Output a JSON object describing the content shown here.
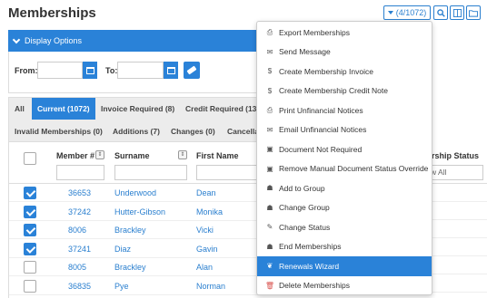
{
  "page": {
    "title": "Memberships"
  },
  "toolbar": {
    "count_label": "(4/1072)"
  },
  "display_options": {
    "label": "Display Options"
  },
  "filters": {
    "from_label": "From:",
    "to_label": "To:"
  },
  "tabs": [
    {
      "label": "All",
      "active": false
    },
    {
      "label": "Current (1072)",
      "active": true
    },
    {
      "label": "Invoice Required (8)",
      "active": false
    },
    {
      "label": "Credit Required (13",
      "active": false
    },
    {
      "label": "Invalid Memberships (0)",
      "active": false
    },
    {
      "label": "Additions (7)",
      "active": false
    },
    {
      "label": "Changes (0)",
      "active": false
    },
    {
      "label": "Cancella",
      "active": false
    }
  ],
  "table": {
    "headers": {
      "member_no": "Member #",
      "surname": "Surname",
      "first_name": "First Name"
    },
    "status_header": "ership Status",
    "status_filter": "w All",
    "rows": [
      {
        "checked": true,
        "member_no": "36653",
        "surname": "Underwood",
        "first_name": "Dean"
      },
      {
        "checked": true,
        "member_no": "37242",
        "surname": "Hutter-Gibson",
        "first_name": "Monika"
      },
      {
        "checked": true,
        "member_no": "8006",
        "surname": "Brackley",
        "first_name": "Vicki"
      },
      {
        "checked": true,
        "member_no": "37241",
        "surname": "Diaz",
        "first_name": "Gavin"
      },
      {
        "checked": false,
        "member_no": "8005",
        "surname": "Brackley",
        "first_name": "Alan"
      },
      {
        "checked": false,
        "member_no": "36835",
        "surname": "Pye",
        "first_name": "Norman"
      }
    ]
  },
  "menu": {
    "items": [
      {
        "label": "Export Memberships",
        "icon": "file-export-icon",
        "glyph": "⎙"
      },
      {
        "label": "Send Message",
        "icon": "envelope-icon",
        "glyph": "✉"
      },
      {
        "label": "Create Membership Invoice",
        "icon": "dollar-icon",
        "glyph": "$"
      },
      {
        "label": "Create Membership Credit Note",
        "icon": "dollar-icon",
        "glyph": "$"
      },
      {
        "label": "Print Unfinancial Notices",
        "icon": "print-icon",
        "glyph": "⎙"
      },
      {
        "label": "Email Unfinancial Notices",
        "icon": "envelope-icon",
        "glyph": "✉"
      },
      {
        "label": "Document Not Required",
        "icon": "money-icon",
        "glyph": "▣"
      },
      {
        "label": "Remove Manual Document Status Override",
        "icon": "money-icon",
        "glyph": "▣"
      },
      {
        "label": "Add to Group",
        "icon": "group-icon",
        "glyph": "☗"
      },
      {
        "label": "Change Group",
        "icon": "group-icon",
        "glyph": "☗"
      },
      {
        "label": "Change Status",
        "icon": "pencil-icon",
        "glyph": "✎"
      },
      {
        "label": "End Memberships",
        "icon": "group-icon",
        "glyph": "☗"
      },
      {
        "label": "Renewals Wizard",
        "icon": "leaf-icon",
        "glyph": "❦",
        "highlighted": true
      },
      {
        "label": "Delete Memberships",
        "icon": "trash-icon",
        "glyph": "🗑",
        "danger": true
      }
    ]
  },
  "colors": {
    "accent": "#2a82d8",
    "link": "#2a7fcf",
    "danger": "#d9534f"
  }
}
